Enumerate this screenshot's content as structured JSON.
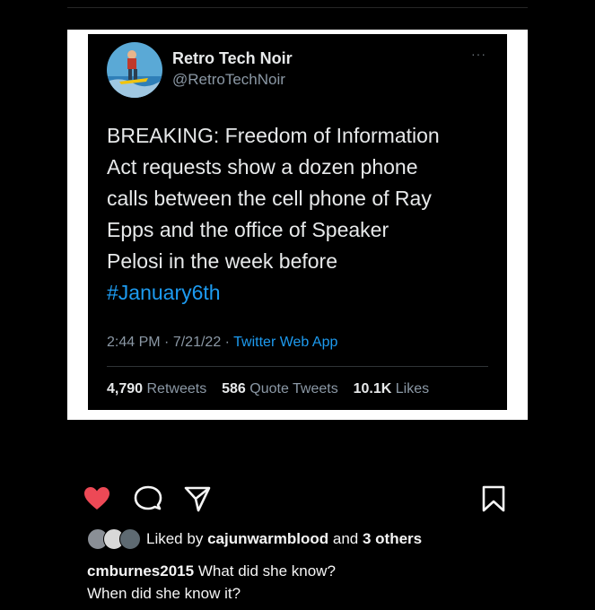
{
  "post": {
    "liked_by_prefix": "Liked by",
    "liked_by_user": "cajunwarmblood",
    "liked_by_and": "and",
    "liked_by_others": "3 others",
    "caption_user": "cmburnes2015",
    "caption_line1": "What did she know?",
    "caption_line2": "When did she know it?",
    "like_color": "#ed4956",
    "icons": [
      "heart-icon",
      "comment-icon",
      "share-icon",
      "bookmark-icon"
    ]
  },
  "tweet": {
    "author_name": "Retro Tech Noir",
    "author_handle": "@RetroTechNoir",
    "more": "···",
    "body_lines": [
      "BREAKING: Freedom of Information",
      "Act requests show a dozen phone",
      "calls between the cell phone of Ray",
      "Epps and the office of Speaker",
      "Pelosi in the week before"
    ],
    "hashtag": "#January6th",
    "time": "2:44 PM",
    "date": "7/21/22",
    "source": "Twitter Web App",
    "retweets_count": "4,790",
    "retweets_label": "Retweets",
    "quotes_count": "586",
    "quotes_label": "Quote Tweets",
    "likes_count": "10.1K",
    "likes_label": "Likes",
    "link_color": "#1d9bf0"
  }
}
